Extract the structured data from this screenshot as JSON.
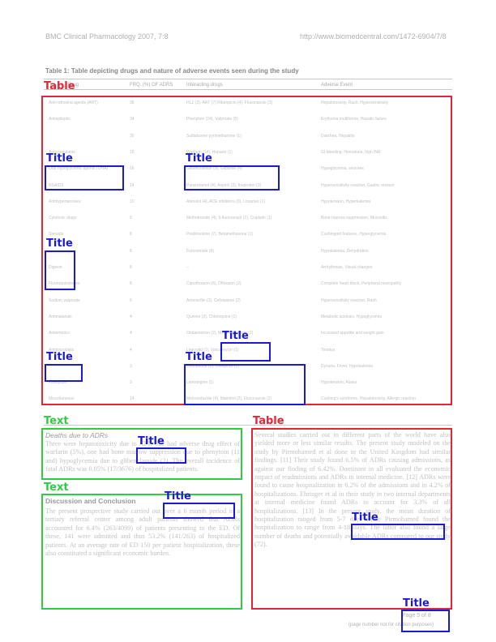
{
  "header": {
    "journal": "BMC Clinical Pharmacology 2007, 7:8",
    "url": "http://www.biomedcentral.com/1472-6904/7/8"
  },
  "table": {
    "caption": "Table 1: Table depicting drugs and nature of adverse events seen during the study",
    "columns": [
      "Drug",
      "FRQ. (%) OF ADRS",
      "Interacting drugs",
      "Adverse Event"
    ],
    "rows": [
      {
        "drug": "Anti-retroviral agents (ART)",
        "freq": "36",
        "interacting": "HLZ (3), ART (7) Rifampicin (4), Fluconazole (3)",
        "event": "Hepatotoxicity, Rash, Hypersensitivity"
      },
      {
        "drug": "Antiepileptic",
        "freq": "34",
        "interacting": "Phenytoin (24), Valproate (5)",
        "event": "Erythema multiforme, Hepatic failure"
      },
      {
        "drug": "",
        "freq": "30",
        "interacting": "Sulfadoxine pyrimethamine (1)",
        "event": "Diarrhea, Hepatitis"
      },
      {
        "drug": "Anticoagulants",
        "freq": "16",
        "interacting": "Warfarin (14), Heparin (1)",
        "event": "GI bleeding, Hematuria, high INR"
      },
      {
        "drug": "Oral hypoglycemic agents (OHA)",
        "freq": "16",
        "interacting": "Glibenclamide (9), Glipizide (4)",
        "event": "Hypoglycemia, seizures"
      },
      {
        "drug": "NSAIDS",
        "freq": "14",
        "interacting": "Paracetamol (4), Aspirin (3), Ibuprofen (3)",
        "event": "Hypersensitivity reaction, Gastric erosion"
      },
      {
        "drug": "Antihypertensives",
        "freq": "10",
        "interacting": "Atenolol (4), ACE inhibitors (3), Losartan (1)",
        "event": "Hypotension, Hyperkalemia"
      },
      {
        "drug": "Cytotoxic drugs",
        "freq": "9",
        "interacting": "Methotrexate (4), 5-fluorouracil (2), Cisplatin (1)",
        "event": "Bone marrow suppression, Mucositis"
      },
      {
        "drug": "Steroids",
        "freq": "8",
        "interacting": "Prednisolone (7), Betamethasone (1)",
        "event": "Cushingoid features, Hyperglycemia"
      },
      {
        "drug": "",
        "freq": "8",
        "interacting": "Furosemide (8)",
        "event": "Hypokalemia, Dehydration"
      },
      {
        "drug": "Digoxin",
        "freq": "8",
        "interacting": "--",
        "event": "Arrhythmias, Visual changes"
      },
      {
        "drug": "Fluoroquinolones",
        "freq": "8",
        "interacting": "Ciprofloxacin (6), Ofloxacin (2)",
        "event": "Complete heart block, Peripheral neuropathy"
      },
      {
        "drug": "Sodium valproate",
        "freq": "6",
        "interacting": "Amoxicillin (3), Cefotaxime (2)",
        "event": "Hypersensitivity reaction, Rash"
      },
      {
        "drug": "Antimalarials",
        "freq": "4",
        "interacting": "Quinine (3), Chloroquine (1)",
        "event": "Metabolic acidosis, Hypoglycemia"
      },
      {
        "drug": "Antiemetics",
        "freq": "4",
        "interacting": "Ondansetron (2), Metoclopramide (2)",
        "event": "Increased appetite and weight gain"
      },
      {
        "drug": "Antimicrobials",
        "freq": "4",
        "interacting": "Linezolid (1), Vancomycin (1)",
        "event": "Tinnitus"
      },
      {
        "drug": "",
        "freq": "3",
        "interacting": "Ceftriaxone (2), Cefepime (1)",
        "event": "Dysuria, Fever, Hypokalemia"
      },
      {
        "drug": "Phenytoin",
        "freq": "3",
        "interacting": "Lamotrigine (1)",
        "event": "Hypotension, Ataxia"
      },
      {
        "drug": "Miscellaneous",
        "freq": "14",
        "interacting": "Metronidazole (4), Mannitol (2), Fluconazole (2)",
        "event": "Cushing's syndrome, Hepatotoxicity, Allergic reaction"
      }
    ]
  },
  "sections": {
    "deaths": {
      "heading": "Deaths due to ADRs",
      "text": "Three were hepatotoxicity due to ATT, one had adverse drug effect of warfarin (5%), one had bone marrow suppression due to phenytoin (11 and) hypoglycemia due to glibenclamide (2). The overall incidence of fatal ADRs was 0.05% (17/3676) of hospitalized patients."
    },
    "discussion": {
      "heading": "Discussion and Conclusion",
      "text": "The present prospective study carried out over a 6 month period in a tertiary referral center among adult patients showed that ADRs accounted for 6.4% (263/4099) of patients presenting to the ED. Of these, 141 were admitted and thus 53.2% (141/263) of hospitalized patients. At an average rate of ED 150 per patient hospitalization, these also constituted a significant economic burden."
    },
    "right_column": {
      "text": "Several studies carried out in different parts of the world have also yielded more or less similar results. The present study modeled on the study by Pirmohamed et al done in the United Kingdom had similar findings. [11] Their study found 6.5% of ADRs causing admissions, as against our finding of 6.42%. Dominant in all evaluated the economic impact of readmissions and ADRs in internal medicine. [12] ADRs were found to cause hospitalization in 6.2% of the admissions and in 4.2% of hospitalizations. Ehringer et al in their study in two internal departments at internal medicine found ADRs to account for 3.3% of all hospitalizations. [13] In the present study, the mean duration of hospitalization ranged from 5-7 days while Pirmohamed found the hospitalization to range from 4-18 days. The latter also found a large number of deaths and potentially avoidable ADRs compared to our study (72)."
    }
  },
  "footer": {
    "page": "Page 5 of 8",
    "note": "(page number not for citation purposes)"
  },
  "annotations": {
    "labels": {
      "table": "Table",
      "title": "Title",
      "text": "Text"
    },
    "colors": {
      "table": "#e32636",
      "text": "#2ecc40",
      "title": "#1a1ad6"
    }
  }
}
